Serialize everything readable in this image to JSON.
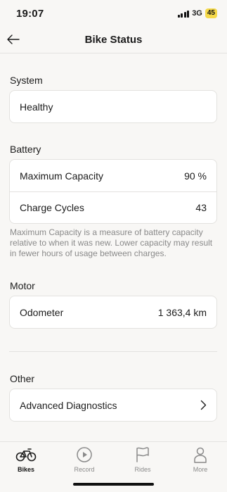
{
  "status_bar": {
    "time": "19:07",
    "network": "3G",
    "battery": "45",
    "battery_color": "#f5d94a"
  },
  "nav": {
    "title": "Bike Status",
    "back_icon": "arrow-left-icon"
  },
  "sections": {
    "system": {
      "title": "System",
      "value": "Healthy"
    },
    "battery": {
      "title": "Battery",
      "rows": [
        {
          "label": "Maximum Capacity",
          "value": "90 %"
        },
        {
          "label": "Charge Cycles",
          "value": "43"
        }
      ],
      "note": "Maximum Capacity is a measure of battery capacity relative to when it was new. Lower capacity may result in fewer hours of usage between charges."
    },
    "motor": {
      "title": "Motor",
      "rows": [
        {
          "label": "Odometer",
          "value": "1 363,4 km"
        }
      ]
    },
    "other": {
      "title": "Other",
      "rows": [
        {
          "label": "Advanced Diagnostics",
          "icon": "chevron-right-icon"
        }
      ]
    }
  },
  "tabs": [
    {
      "label": "Bikes",
      "icon": "bike-icon",
      "active": true
    },
    {
      "label": "Record",
      "icon": "play-circle-icon",
      "active": false
    },
    {
      "label": "Rides",
      "icon": "flag-icon",
      "active": false
    },
    {
      "label": "More",
      "icon": "person-icon",
      "active": false
    }
  ]
}
